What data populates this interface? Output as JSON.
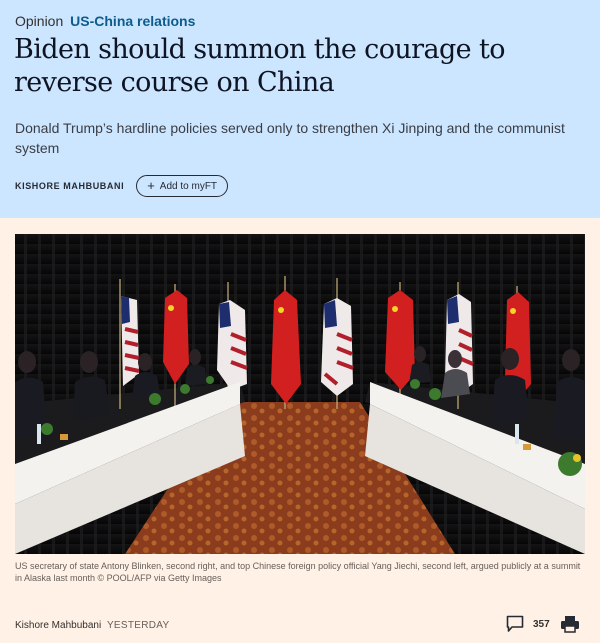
{
  "article": {
    "kicker_label": "Opinion",
    "kicker_topic": "US-China relations",
    "headline": "Biden should summon the courage to reverse course on China",
    "standfirst": "Donald Trump’s hardline policies served only to strengthen Xi Jinping and the communist system",
    "author_caps": "KISHORE MAHBUBANI",
    "add_button_label": "Add to myFT"
  },
  "image": {
    "caption": "US secretary of state Antony Blinken, second right, and top Chinese foreign policy official Yang Jiechi, second left, argued publicly at a summit in Alaska last month © POOL/AFP via Getty Images"
  },
  "footer": {
    "author": "Kishore Mahbubani",
    "published": "YESTERDAY",
    "comment_count": "357"
  },
  "icons": {
    "comment": "speech-bubble-icon",
    "print": "printer-icon",
    "add": "plus-icon"
  },
  "colors": {
    "header_band": "#cce6ff",
    "page_background": "#fff1e5",
    "topic_link": "#0d5c8c"
  }
}
